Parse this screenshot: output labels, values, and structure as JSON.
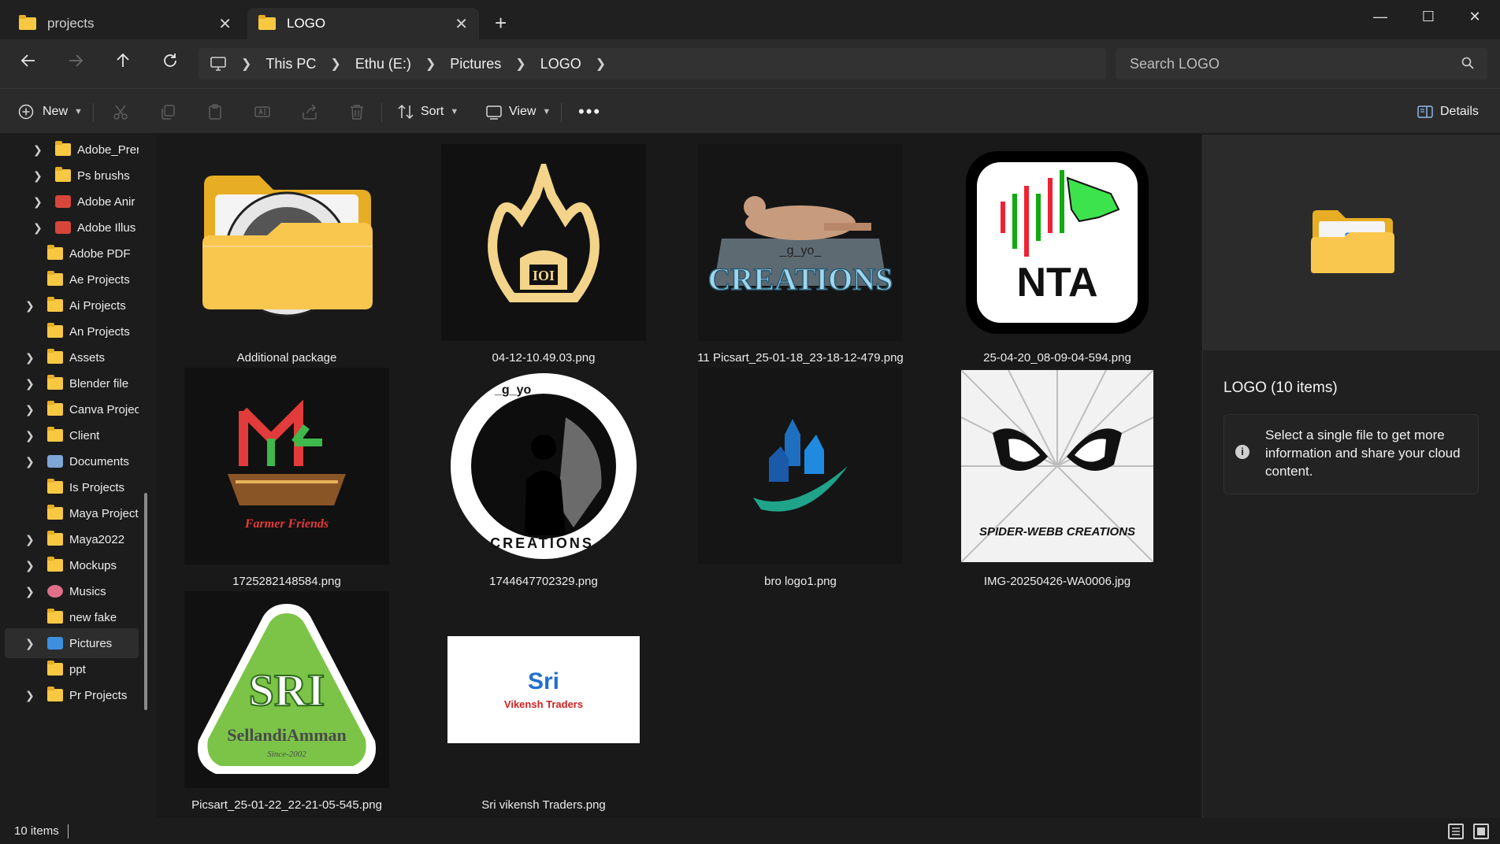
{
  "tabs": [
    {
      "label": "projects",
      "active": false
    },
    {
      "label": "LOGO",
      "active": true
    }
  ],
  "window_controls": {
    "minimize": "—",
    "maximize": "☐",
    "close": "✕"
  },
  "breadcrumb": [
    "This PC",
    "Ethu (E:)",
    "Pictures",
    "LOGO"
  ],
  "search": {
    "placeholder": "Search LOGO"
  },
  "commands": {
    "new_label": "New",
    "sort_label": "Sort",
    "view_label": "View",
    "details_label": "Details"
  },
  "sidebar": {
    "items": [
      {
        "label": "Adobe_Prer",
        "expandable": true,
        "icon": "folder-icon"
      },
      {
        "label": "Ps brushs",
        "expandable": true,
        "icon": "folder-icon"
      },
      {
        "label": "Adobe Anir",
        "expandable": true,
        "icon": "app-folder-icon"
      },
      {
        "label": "Adobe Illus",
        "expandable": true,
        "icon": "app-folder-icon"
      },
      {
        "label": "Adobe PDF",
        "expandable": false,
        "icon": "folder-icon"
      },
      {
        "label": "Ae Projects",
        "expandable": false,
        "icon": "folder-icon"
      },
      {
        "label": "Ai Projects",
        "expandable": true,
        "icon": "folder-icon"
      },
      {
        "label": "An Projects",
        "expandable": false,
        "icon": "folder-icon"
      },
      {
        "label": "Assets",
        "expandable": true,
        "icon": "folder-icon"
      },
      {
        "label": "Blender file",
        "expandable": true,
        "icon": "folder-icon"
      },
      {
        "label": "Canva Projec",
        "expandable": true,
        "icon": "folder-icon"
      },
      {
        "label": "Client",
        "expandable": true,
        "icon": "folder-icon"
      },
      {
        "label": "Documents",
        "expandable": true,
        "icon": "documents-icon"
      },
      {
        "label": "Is Projects",
        "expandable": false,
        "icon": "folder-icon"
      },
      {
        "label": "Maya Project",
        "expandable": false,
        "icon": "folder-icon"
      },
      {
        "label": "Maya2022",
        "expandable": true,
        "icon": "folder-icon"
      },
      {
        "label": "Mockups",
        "expandable": true,
        "icon": "folder-icon"
      },
      {
        "label": "Musics",
        "expandable": true,
        "icon": "music-icon"
      },
      {
        "label": "new fake",
        "expandable": false,
        "icon": "folder-icon"
      },
      {
        "label": "Pictures",
        "expandable": true,
        "icon": "pictures-icon",
        "selected": true
      },
      {
        "label": "ppt",
        "expandable": false,
        "icon": "folder-icon"
      },
      {
        "label": "Pr Projects",
        "expandable": true,
        "icon": "folder-icon"
      }
    ]
  },
  "files": [
    {
      "name": "Additional package",
      "kind": "folder"
    },
    {
      "name": "04-12-10.49.03.png",
      "kind": "image"
    },
    {
      "name": "11 Picsart_25-01-18_23-18-12-479.png",
      "kind": "image"
    },
    {
      "name": "25-04-20_08-09-04-594.png",
      "kind": "image"
    },
    {
      "name": "1725282148584.png",
      "kind": "image"
    },
    {
      "name": "1744647702329.png",
      "kind": "image"
    },
    {
      "name": "bro logo1.png",
      "kind": "image"
    },
    {
      "name": "IMG-20250426-WA0006.jpg",
      "kind": "image"
    },
    {
      "name": "Picsart_25-01-22_22-21-05-545.png",
      "kind": "image"
    },
    {
      "name": "Sri vikensh Traders.png",
      "kind": "image"
    }
  ],
  "logo_text": {
    "creations": "CREATIONS",
    "gyo": "_g_yo_",
    "nta": "NTA",
    "farmer": "Farmer Friends",
    "creations_ring": "CREATIONS",
    "spider": "SPIDER-WEBB CREATIONS",
    "sri": "SRI",
    "sellandi": "SellandiAmman",
    "since": "Since-2002",
    "vikensh_sri": "Sri",
    "vikensh": "Vikensh Traders"
  },
  "details_pane": {
    "title": "LOGO (10 items)",
    "info": "Select a single file to get more information and share your cloud content."
  },
  "status": {
    "count": "10 items"
  }
}
